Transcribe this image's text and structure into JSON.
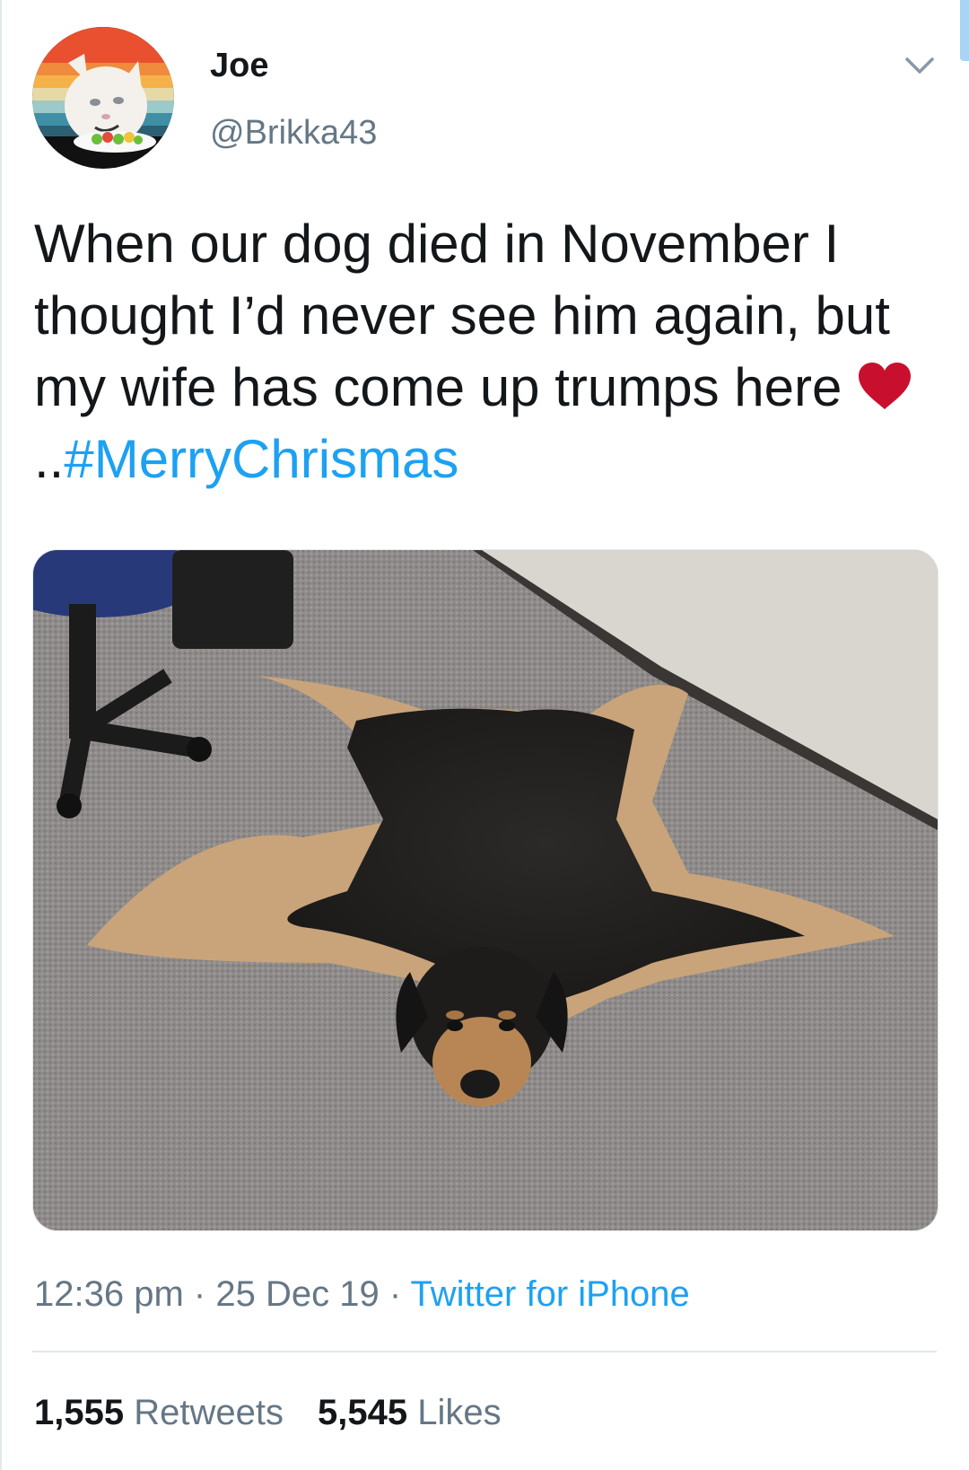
{
  "user": {
    "display_name": "Joe",
    "handle": "@Brikka43",
    "avatar_icon": "cat-avatar-icon"
  },
  "tweet": {
    "text_before_heart": "When our dog died in November I thought I’d never see him again, but my wife has come up trumps here ",
    "emoji": "red-heart-icon",
    "text_after_heart": "..",
    "hashtag": "#MerryChrismas"
  },
  "meta": {
    "time": "12:36 pm",
    "separator": "·",
    "date": "25 Dec 19",
    "source": "Twitter for iPhone"
  },
  "stats": {
    "retweets_count": "1,555",
    "retweets_label": "Retweets",
    "likes_count": "5,545",
    "likes_label": "Likes"
  },
  "colors": {
    "link": "#1da1f2",
    "secondary": "#657786",
    "primary": "#14171a",
    "heart": "#c8102e"
  }
}
